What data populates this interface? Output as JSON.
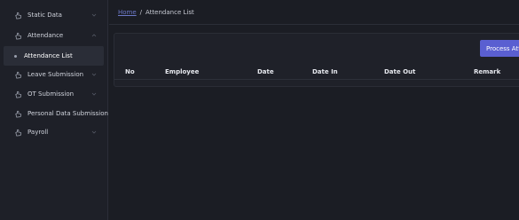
{
  "sidebar": {
    "items": [
      {
        "label": "Static Data",
        "icon": "hand-icon",
        "expandable": true
      },
      {
        "label": "Attendance",
        "icon": "hand-icon",
        "expandable": true,
        "expanded": true
      },
      {
        "label": "Attendance List",
        "icon": "dot-icon",
        "active": true
      },
      {
        "label": "Leave Submission",
        "icon": "hand-icon",
        "expandable": true
      },
      {
        "label": "OT Submission",
        "icon": "hand-icon",
        "expandable": true
      },
      {
        "label": "Personal Data Submission",
        "icon": "hand-icon",
        "expandable": false
      },
      {
        "label": "Payroll",
        "icon": "hand-icon",
        "expandable": true
      }
    ]
  },
  "breadcrumb": {
    "home": "Home",
    "separator": "/",
    "current": "Attendance List"
  },
  "toolbar": {
    "process_label": "Process Atte"
  },
  "table": {
    "columns": [
      "No",
      "Employee",
      "Date",
      "Date In",
      "Date Out",
      "Remark"
    ],
    "rows": []
  },
  "colors": {
    "background": "#1b1d24",
    "sidebar": "#1e2028",
    "accent": "#5a5fd1",
    "link": "#6c79c8"
  }
}
